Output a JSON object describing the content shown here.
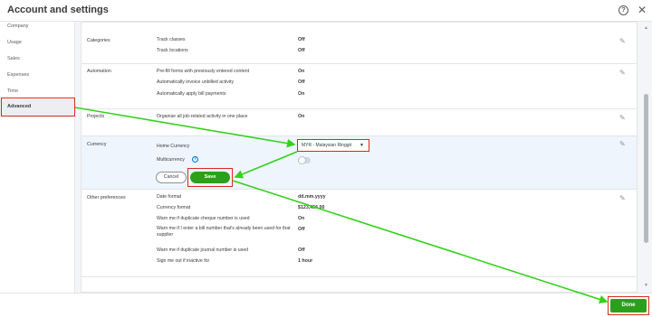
{
  "header": {
    "title": "Account and settings",
    "help_glyph": "?",
    "close_glyph": "✕"
  },
  "sidebar": {
    "items": [
      {
        "label": "Company"
      },
      {
        "label": "Usage"
      },
      {
        "label": "Sales"
      },
      {
        "label": "Expenses"
      },
      {
        "label": "Time"
      },
      {
        "label": "Advanced"
      }
    ]
  },
  "sections": {
    "categories": {
      "label": "Categories",
      "rows": [
        {
          "label": "Track classes",
          "value": "Off"
        },
        {
          "label": "Track locations",
          "value": "Off"
        }
      ]
    },
    "automation": {
      "label": "Automation",
      "rows": [
        {
          "label": "Pre-fill forms with previously entered content",
          "value": "On"
        },
        {
          "label": "Automatically invoice unbilled activity",
          "value": "Off"
        },
        {
          "label": "Automatically apply bill payments",
          "value": "On"
        }
      ]
    },
    "projects": {
      "label": "Projects",
      "rows": [
        {
          "label": "Organise all job-related activity in one place",
          "value": "On"
        }
      ]
    },
    "currency": {
      "label": "Currency",
      "home_currency_label": "Home Currency",
      "home_currency_value": "MYR - Malaysian Ringgit",
      "multicurrency_label": "Multicurrency",
      "info_glyph": "?",
      "cancel_label": "Cancel",
      "save_label": "Save"
    },
    "other": {
      "label": "Other preferences",
      "rows": [
        {
          "label": "Date format",
          "value": "dd.mm.yyyy"
        },
        {
          "label": "Currency format",
          "value": "$123,456.00"
        },
        {
          "label": "Warn me if duplicate cheque number is used",
          "value": "On"
        },
        {
          "label": "Warn me if I enter a bill number that's already been used for that supplier",
          "value": "Off"
        },
        {
          "label": "Warn me if duplicate journal number is used",
          "value": "Off"
        },
        {
          "label": "Sign me out if inactive for",
          "value": "1 hour"
        }
      ]
    }
  },
  "footer": {
    "done_label": "Done"
  },
  "colors": {
    "accent_green": "#2ca01c",
    "annotation_red": "#d52b1e",
    "arrow_green": "#34d11a"
  }
}
